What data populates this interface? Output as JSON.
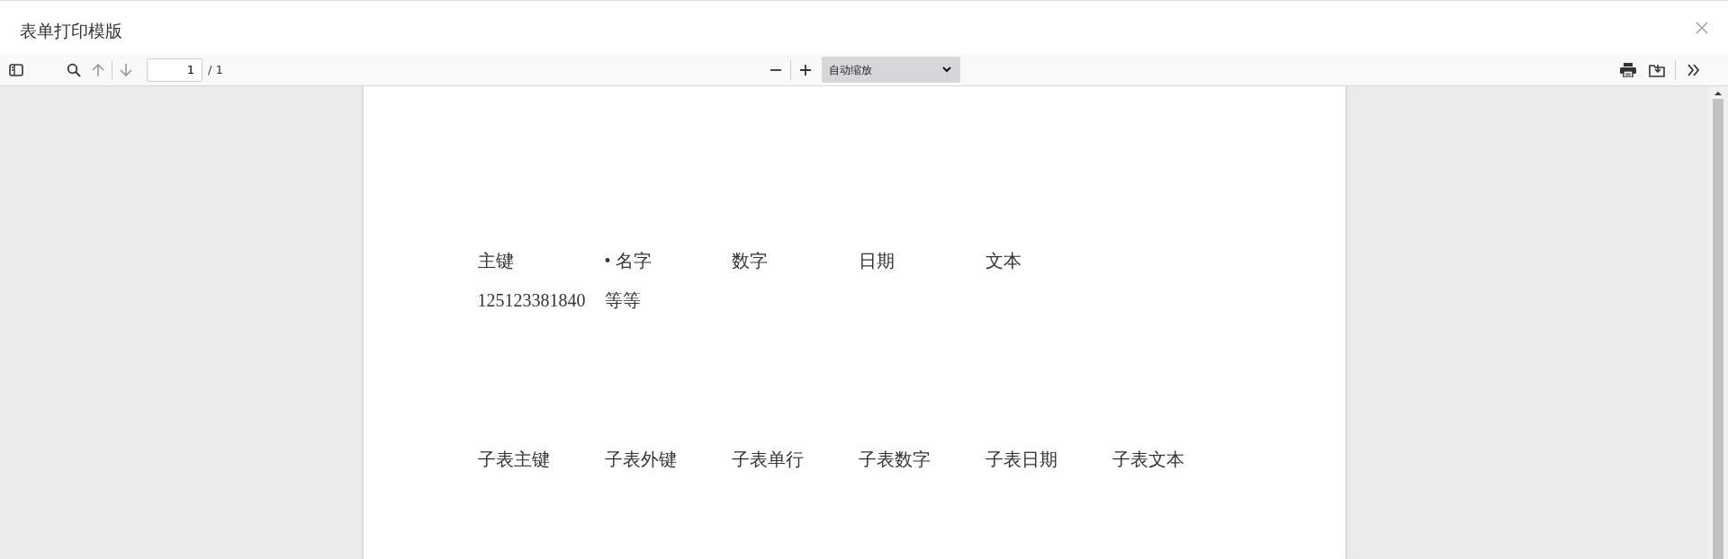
{
  "window": {
    "title": "表单打印模版"
  },
  "toolbar": {
    "page_number": "1",
    "page_count": "/ 1",
    "zoom": "自动缩放"
  },
  "document": {
    "sections": [
      {
        "rows": [
          [
            "主键",
            "• 名字",
            "数字",
            "日期",
            "文本"
          ],
          [
            "125123381840",
            "等等"
          ]
        ]
      },
      {
        "rows": [
          [
            "子表主键",
            "子表外键",
            "子表单行",
            "子表数字",
            "子表日期",
            "子表文本"
          ]
        ]
      }
    ]
  }
}
